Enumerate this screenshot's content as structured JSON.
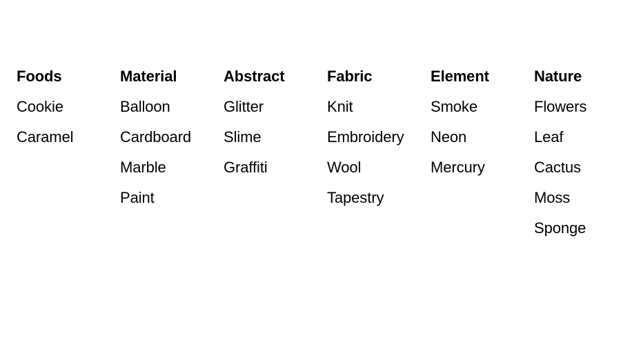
{
  "page": {
    "background_color": "#ffffff",
    "text_color": "#000000"
  },
  "columns": [
    {
      "header": "Foods",
      "items": [
        "Cookie",
        "Caramel"
      ]
    },
    {
      "header": "Material",
      "items": [
        "Balloon",
        "Cardboard",
        "Marble",
        "Paint"
      ]
    },
    {
      "header": "Abstract",
      "items": [
        "Glitter",
        "Slime",
        "Graffiti"
      ]
    },
    {
      "header": "Fabric",
      "items": [
        "Knit",
        "Embroidery",
        "Wool",
        "Tapestry"
      ]
    },
    {
      "header": "Element",
      "items": [
        "Smoke",
        "Neon",
        "Mercury"
      ]
    },
    {
      "header": "Nature",
      "items": [
        "Flowers",
        "Leaf",
        "Cactus",
        "Moss",
        "Sponge"
      ]
    }
  ]
}
